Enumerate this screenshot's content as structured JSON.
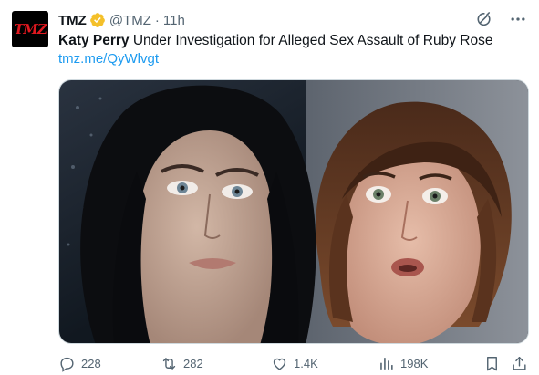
{
  "author": {
    "avatar_text": "TMZ",
    "name": "TMZ",
    "handle": "@TMZ",
    "separator": "·",
    "time": "11h",
    "verified_color": "#f4c02a"
  },
  "tweet": {
    "bold_text": "Katy Perry",
    "text": " Under Investigation for Alleged Sex Assault of Ruby Rose",
    "link": "tmz.me/QyWlvgt"
  },
  "stats": {
    "replies": "228",
    "retweets": "282",
    "likes": "1.4K",
    "views": "198K"
  },
  "icons": {
    "grok": "grok-icon",
    "more": "more-icon",
    "reply": "reply-icon",
    "retweet": "retweet-icon",
    "like": "heart-icon",
    "views": "views-icon",
    "bookmark": "bookmark-icon",
    "share": "share-icon"
  },
  "colors": {
    "link": "#1d9bf0",
    "muted": "#536471",
    "text": "#0f1419",
    "brand_red": "#e0181f"
  }
}
